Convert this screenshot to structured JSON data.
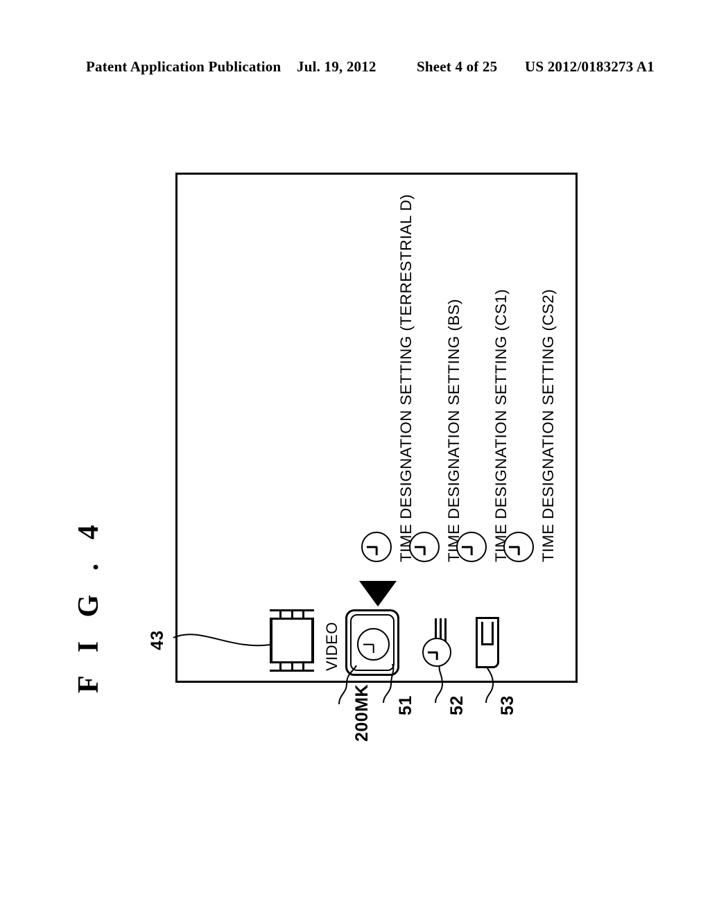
{
  "header": {
    "publication": "Patent Application Publication",
    "date": "Jul. 19, 2012",
    "sheet": "Sheet 4 of 25",
    "number": "US 2012/0183273 A1"
  },
  "figure": {
    "label": "F I G . 4",
    "screen_reference": "43"
  },
  "menu": {
    "items": [
      {
        "icon": "clock-icon",
        "label": "TIME DESIGNATION SETTING (TERRESTRIAL D)"
      },
      {
        "icon": "clock-icon",
        "label": "TIME DESIGNATION SETTING (BS)"
      },
      {
        "icon": "clock-icon",
        "label": "TIME DESIGNATION SETTING (CS1)"
      },
      {
        "icon": "clock-icon",
        "label": "TIME DESIGNATION SETTING (CS2)"
      }
    ]
  },
  "icon_bar": {
    "items": [
      {
        "icon": "film-strip-icon",
        "label": "VIDEO",
        "reference": "200MK"
      },
      {
        "icon": "clock-icon",
        "label": "",
        "reference": "51",
        "selected": true
      },
      {
        "icon": "antenna-clock-icon",
        "label": "",
        "reference": "52"
      },
      {
        "icon": "card-icon",
        "label": "",
        "reference": "53"
      }
    ],
    "cursor": "cursor-triangle"
  },
  "colors": {
    "ink": "#000000",
    "paper": "#ffffff"
  }
}
